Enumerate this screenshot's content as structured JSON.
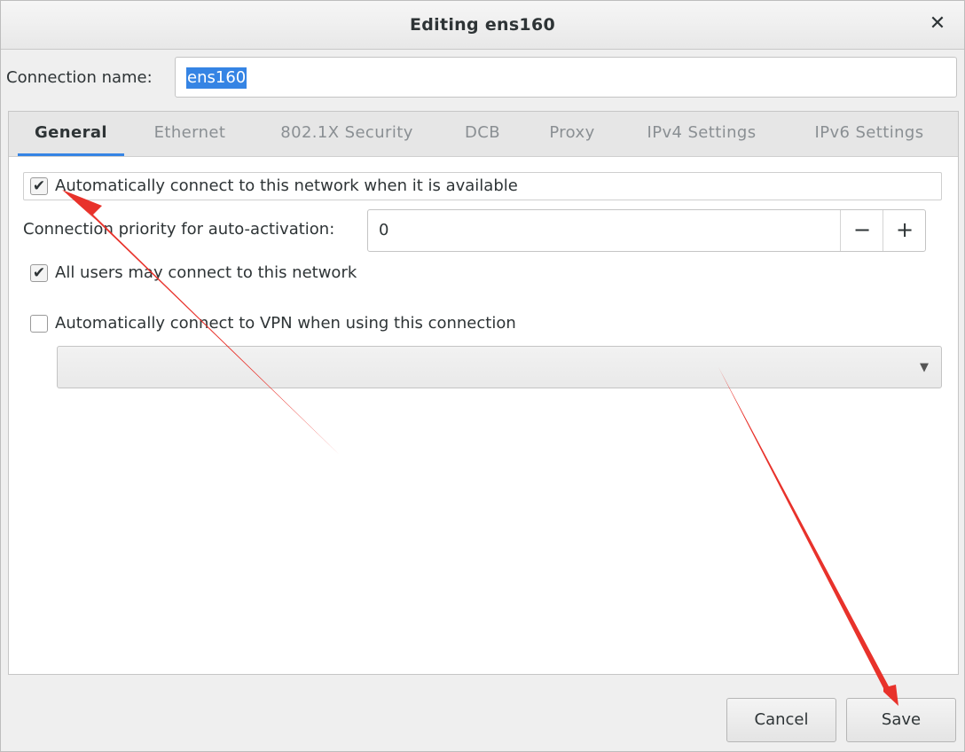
{
  "window": {
    "title": "Editing ens160"
  },
  "connection": {
    "label": "Connection name:",
    "value": "ens160"
  },
  "tabs": [
    {
      "label": "General",
      "active": true
    },
    {
      "label": "Ethernet",
      "active": false
    },
    {
      "label": "802.1X Security",
      "active": false
    },
    {
      "label": "DCB",
      "active": false
    },
    {
      "label": "Proxy",
      "active": false
    },
    {
      "label": "IPv4 Settings",
      "active": false
    },
    {
      "label": "IPv6 Settings",
      "active": false
    }
  ],
  "general": {
    "auto_connect": {
      "label": "Automatically connect to this network when it is available",
      "checked": true
    },
    "priority": {
      "label": "Connection priority for auto-activation:",
      "value": "0",
      "minus": "−",
      "plus": "+"
    },
    "all_users": {
      "label": "All users may connect to this network",
      "checked": true
    },
    "vpn": {
      "label": "Automatically connect to VPN when using this connection",
      "checked": false,
      "selected": ""
    }
  },
  "buttons": {
    "cancel": "Cancel",
    "save": "Save"
  },
  "icons": {
    "close": "close-icon",
    "check": "check-icon",
    "dropdown": "chevron-down-icon"
  },
  "colors": {
    "accent": "#3584e4",
    "annotation_arrow": "#e8322b"
  }
}
